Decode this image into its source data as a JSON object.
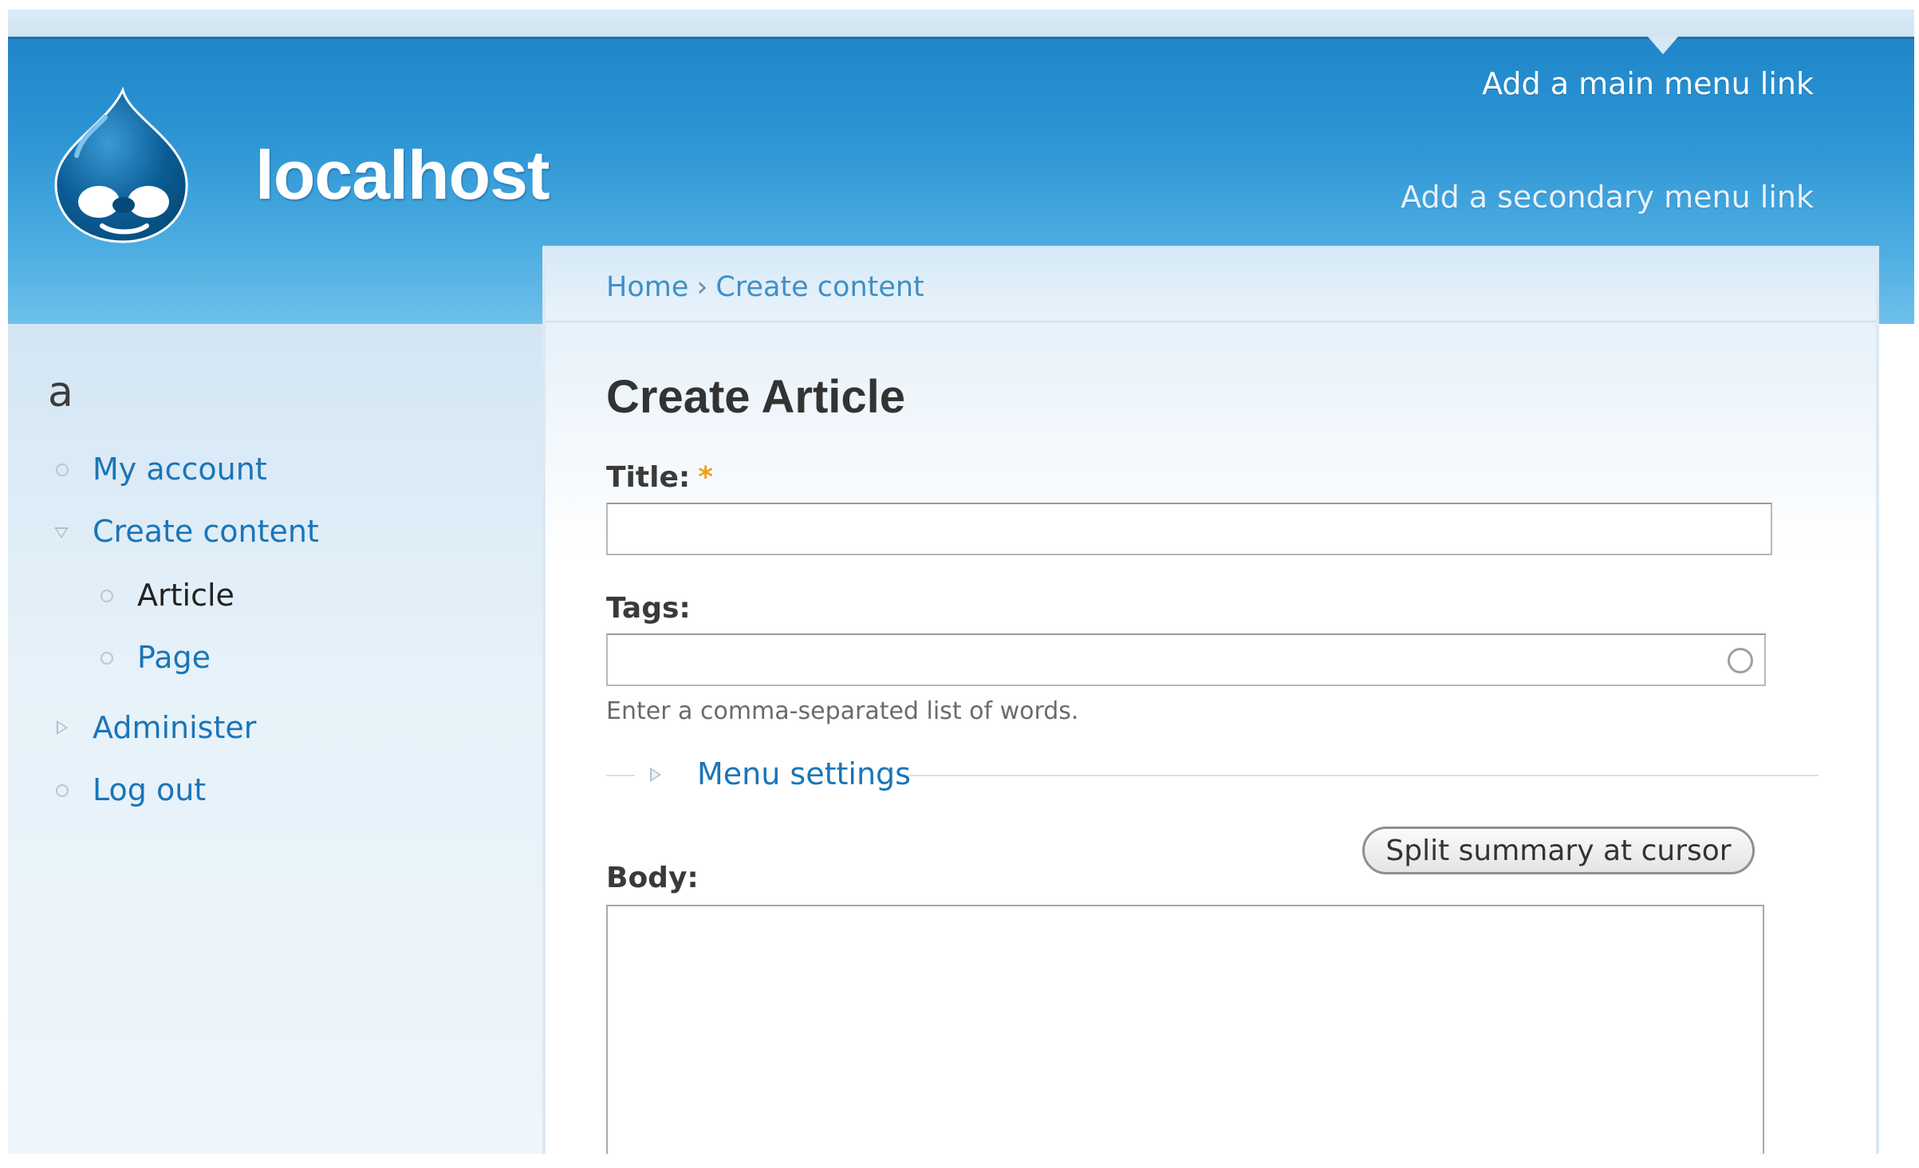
{
  "site": {
    "name": "localhost",
    "main_menu_link": "Add a main menu link",
    "secondary_menu_link": "Add a secondary menu link"
  },
  "sidebar": {
    "title": "a",
    "items": [
      {
        "label": "My account",
        "icon": "circle-bullet-icon"
      },
      {
        "label": "Create content",
        "icon": "triangle-down-icon"
      },
      {
        "label": "Article",
        "icon": "circle-bullet-icon",
        "active": true
      },
      {
        "label": "Page",
        "icon": "circle-bullet-icon"
      },
      {
        "label": "Administer",
        "icon": "triangle-right-icon"
      },
      {
        "label": "Log out",
        "icon": "circle-bullet-icon"
      }
    ]
  },
  "breadcrumb": {
    "items": [
      "Home",
      "Create content"
    ],
    "separator": "›"
  },
  "form": {
    "page_title": "Create Article",
    "title_label": "Title:",
    "required_marker": "*",
    "title_value": "",
    "tags_label": "Tags:",
    "tags_value": "",
    "tags_description": "Enter a comma-separated list of words.",
    "menu_settings_label": "Menu settings",
    "split_summary_button": "Split summary at cursor",
    "body_label": "Body:",
    "body_value": ""
  },
  "colors": {
    "header_blue": "#2d95d4",
    "link_blue": "#1a75b8",
    "required_orange": "#f0a020"
  }
}
